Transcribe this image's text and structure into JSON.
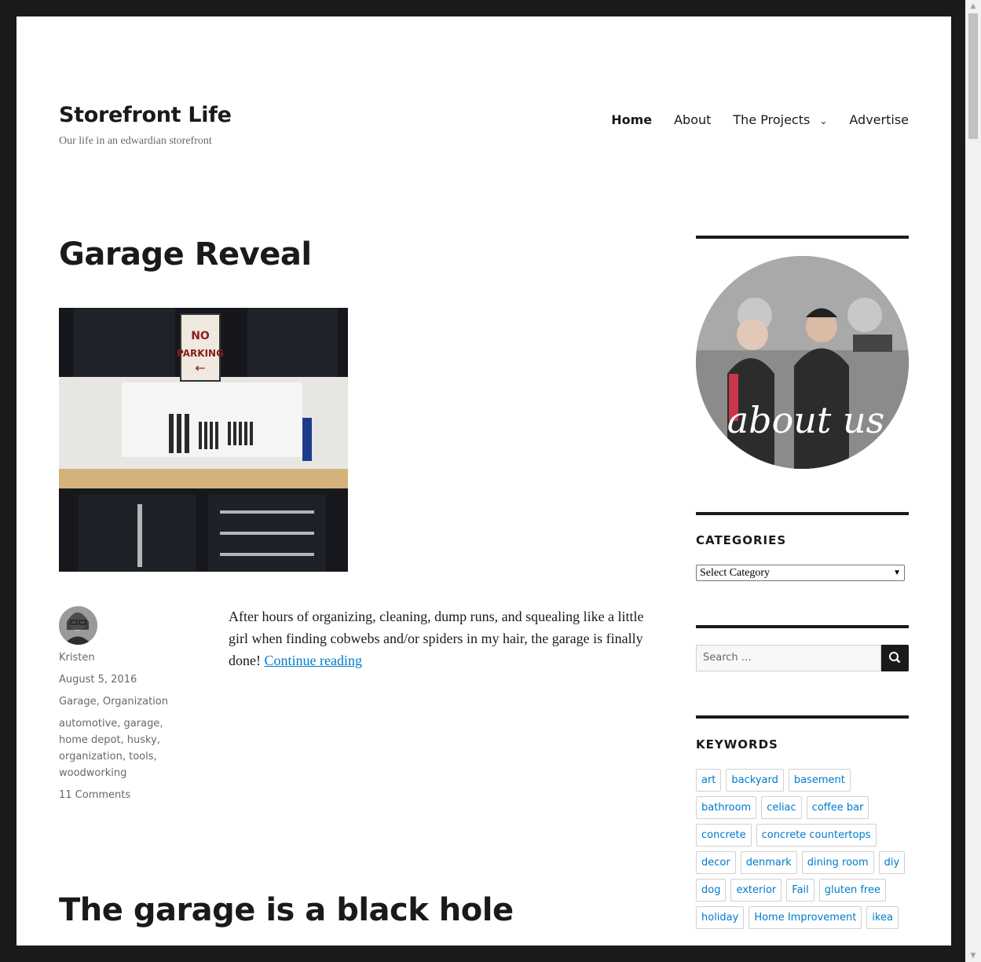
{
  "header": {
    "site_title": "Storefront Life",
    "site_description": "Our life in an edwardian storefront"
  },
  "nav": {
    "items": [
      {
        "label": "Home",
        "current": true
      },
      {
        "label": "About"
      },
      {
        "label": "The Projects",
        "has_submenu": true
      },
      {
        "label": "Advertise"
      }
    ]
  },
  "posts": [
    {
      "title": "Garage Reveal",
      "thumbnail_alt": "Garage workbench with pegboard and tools",
      "author": "Kristen",
      "date": "August 5, 2016",
      "categories": "Garage, Organization",
      "tags_lines": [
        "automotive, garage,",
        "home depot, husky,",
        "organization, tools,",
        "woodworking"
      ],
      "comments": "11 Comments",
      "excerpt": "After hours of organizing, cleaning, dump runs, and squealing like a little girl when finding cobwebs and/or spiders in my hair, the garage is finally done!",
      "continue_label": "Continue reading"
    },
    {
      "title": "The garage is a black hole"
    }
  ],
  "sidebar": {
    "about_image_text": "about us",
    "categories_title": "CATEGORIES",
    "categories_select": "Select Category",
    "search_placeholder": "Search …",
    "keywords_title": "KEYWORDS",
    "keywords": [
      "art",
      "backyard",
      "basement",
      "bathroom",
      "celiac",
      "coffee bar",
      "concrete",
      "concrete countertops",
      "decor",
      "denmark",
      "dining room",
      "diy",
      "dog",
      "exterior",
      "Fail",
      "gluten free",
      "holiday",
      "Home Improvement",
      "ikea"
    ]
  },
  "colors": {
    "accent": "#007acc",
    "text": "#1a1a1a",
    "muted": "#686868",
    "frame": "#1a1a1a"
  }
}
